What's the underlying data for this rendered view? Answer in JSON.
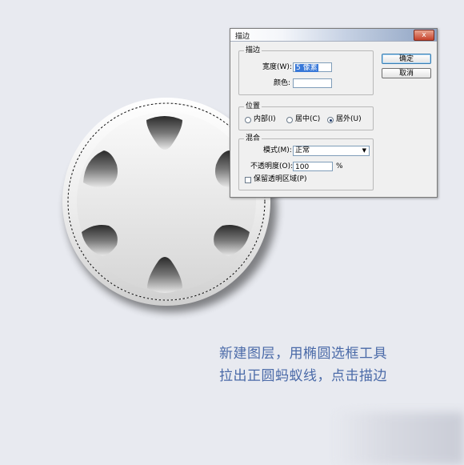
{
  "dialog": {
    "title": "描边",
    "close_label": "x",
    "stroke_group": {
      "legend": "描边",
      "width_label": "宽度(W):",
      "width_value": "5 像素",
      "color_label": "颜色:",
      "color_value": "#ffffff"
    },
    "position_group": {
      "legend": "位置",
      "options": [
        "内部(I)",
        "居中(C)",
        "居外(U)"
      ],
      "selected": "居外(U)"
    },
    "blend_group": {
      "legend": "混合",
      "mode_label": "模式(M):",
      "mode_value": "正常",
      "opacity_label": "不透明度(O):",
      "opacity_value": "100",
      "opacity_unit": "%",
      "preserve_label": "保留透明区域(P)",
      "preserve_checked": false
    },
    "ok_label": "确定",
    "cancel_label": "取消"
  },
  "caption": {
    "line1": "新建图层，用椭圆选框工具",
    "line2": "拉出正圆蚂蚁线，点击描边"
  },
  "colors": {
    "background": "#e8eaf0",
    "caption": "#4a6aa8",
    "selected_text_bg": "#3878d8"
  },
  "icons": [
    "hubcap-artwork",
    "marching-ants-selection",
    "close-icon",
    "dropdown-arrow-icon"
  ]
}
